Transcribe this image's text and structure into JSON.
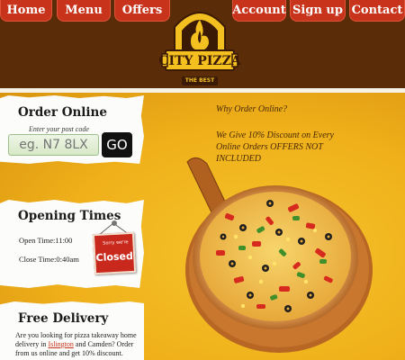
{
  "nav": {
    "home": "Home",
    "menu": "Menu",
    "offers": "Offers",
    "account": "Account",
    "signup": "Sign up",
    "contact": "Contact"
  },
  "logo": {
    "name": "CITY PIZZA",
    "tagline": "THE BEST",
    "icon": "flame-oven-logo"
  },
  "order_online": {
    "title": "Order Online",
    "postcode_label": "Enter your post code",
    "postcode_placeholder": "eg. N7 8LX",
    "go_label": "GO"
  },
  "opening_times": {
    "title": "Opening Times",
    "open": "Open Time:11:00",
    "close": "Close Time:0:40am",
    "sign_small": "Sorry we're",
    "sign_main": "Closed"
  },
  "free_delivery": {
    "title": "Free Delivery",
    "text_before": "Are you looking for pizza takeaway home delivery in ",
    "link": "Islington",
    "text_after": " and Camden? Order from us online and get 10% discount."
  },
  "promo": {
    "heading": "Why Order Online?",
    "body": "We Give 10% Discount on Every Online Orders OFFERS NOT INCLUDED"
  },
  "colors": {
    "header_brown": "#5b2c08",
    "nav_red": "#c8331b",
    "background_yellow": "#f4bf1f",
    "logo_yellow": "#f4c020"
  }
}
